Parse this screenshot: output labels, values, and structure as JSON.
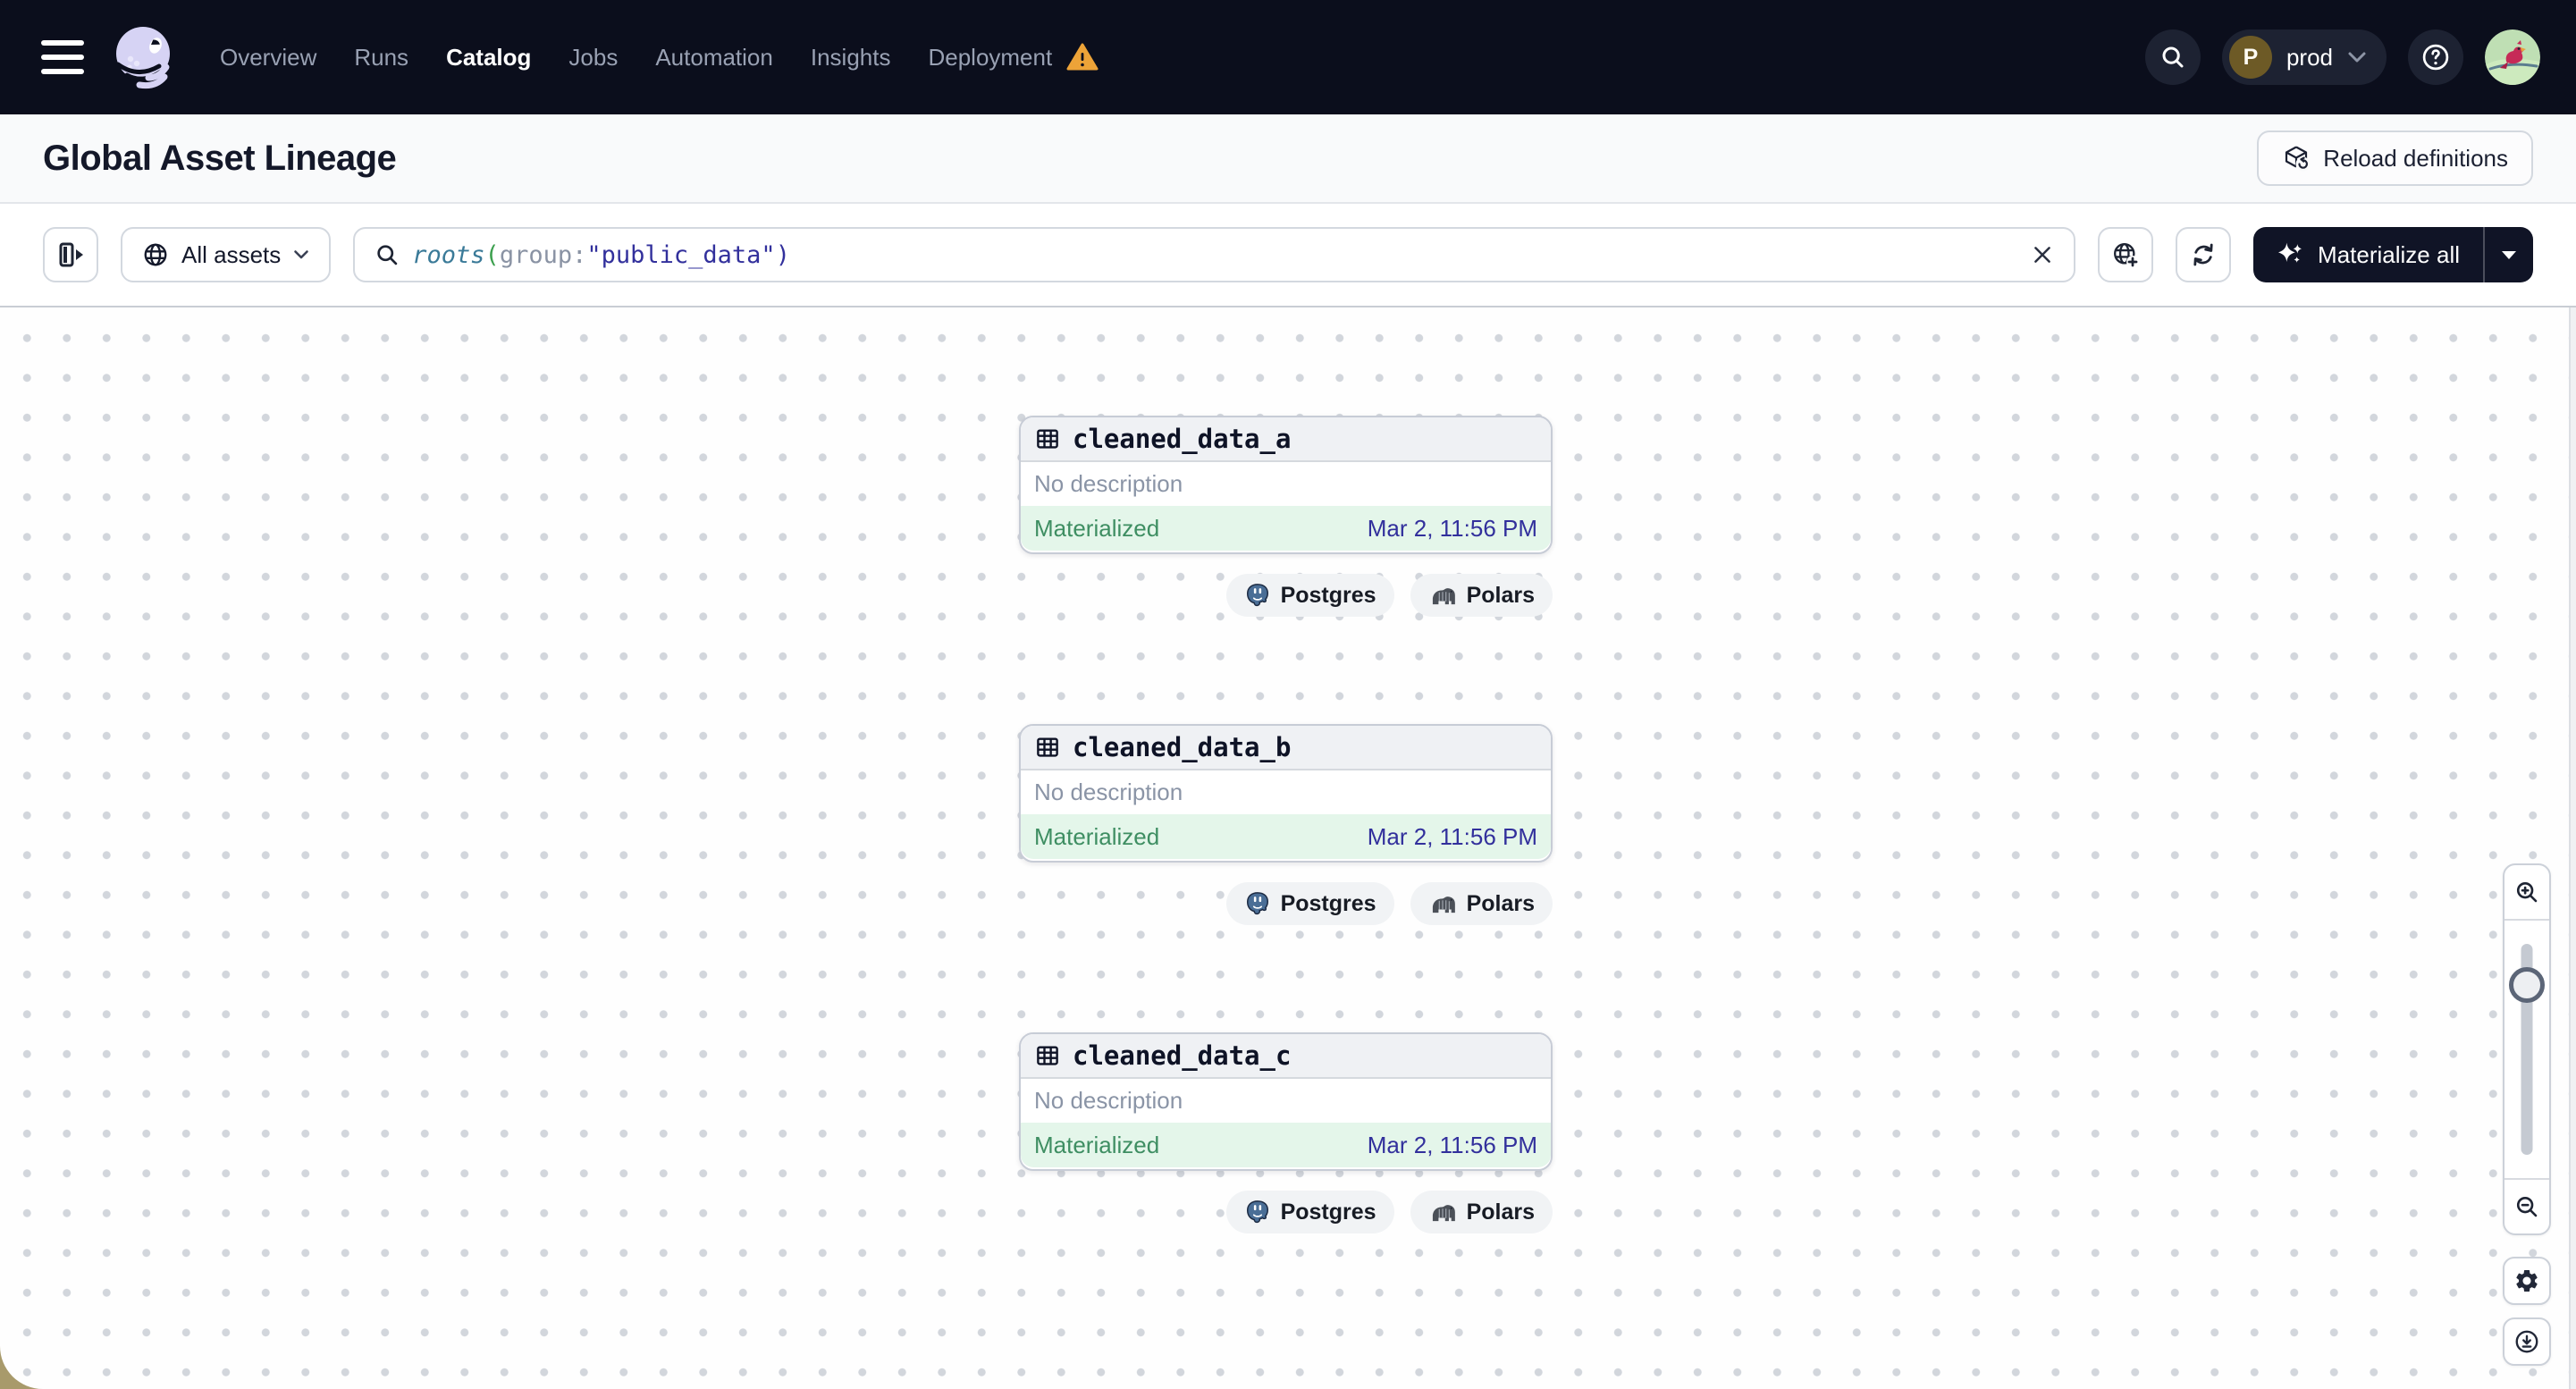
{
  "navbar": {
    "links": [
      "Overview",
      "Runs",
      "Catalog",
      "Jobs",
      "Automation",
      "Insights",
      "Deployment"
    ],
    "active_link": "Catalog",
    "environment": {
      "initial": "P",
      "label": "prod"
    }
  },
  "header": {
    "title": "Global Asset Lineage",
    "reload_label": "Reload definitions"
  },
  "toolbar": {
    "scope_label": "All assets",
    "query": {
      "fn": "roots",
      "open": "(",
      "key": "group",
      "colon": ":",
      "value": "\"public_data\"",
      "close": ")"
    },
    "materialize_label": "Materialize all"
  },
  "graph": {
    "nodes": [
      {
        "name": "cleaned_data_a",
        "description": "No description",
        "status": "Materialized",
        "last_materialized": "Mar 2, 11:56 PM",
        "tags": [
          "Postgres",
          "Polars"
        ]
      },
      {
        "name": "cleaned_data_b",
        "description": "No description",
        "status": "Materialized",
        "last_materialized": "Mar 2, 11:56 PM",
        "tags": [
          "Postgres",
          "Polars"
        ]
      },
      {
        "name": "cleaned_data_c",
        "description": "No description",
        "status": "Materialized",
        "last_materialized": "Mar 2, 11:56 PM",
        "tags": [
          "Postgres",
          "Polars"
        ]
      }
    ]
  },
  "colors": {
    "navbar_bg": "#0b0e1c",
    "dark_button_bg": "#101426",
    "materialized_text": "#3e8e62",
    "materialized_bg": "#e4f6ea",
    "timestamp_text": "#32309c",
    "warning_orange": "#eda338",
    "query_function": "#3a7a98",
    "query_value": "#32309c",
    "grid_dot": "#d2d6dc",
    "logo_lavender": "#d6d3f4"
  }
}
